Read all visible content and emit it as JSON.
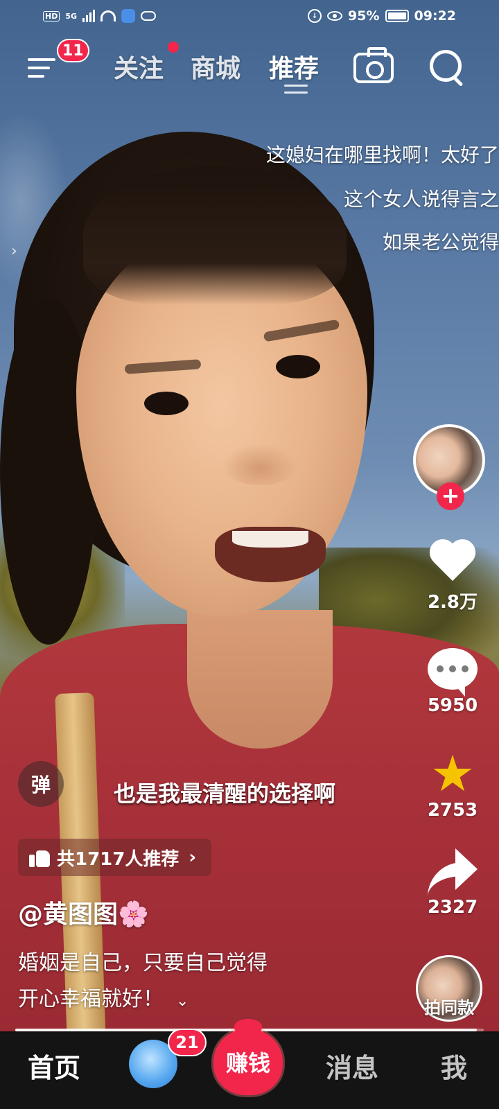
{
  "status_bar": {
    "hd": "HD",
    "network": "5G",
    "battery_percent": "95%",
    "time": "09:22"
  },
  "top_nav": {
    "menu_badge": "11",
    "tabs": [
      "关注",
      "商城",
      "推荐"
    ],
    "active_tab": "推荐"
  },
  "danmaku": [
    "这媳妇在哪里找啊！太好了",
    "这个女人说得言之",
    "如果老公觉得"
  ],
  "side_actions": {
    "likes": "2.8万",
    "comments": "5950",
    "favorites": "2753",
    "shares": "2327",
    "same_style_label": "拍同款"
  },
  "video": {
    "danmu_toggle": "弹",
    "subtitle": "也是我最清醒的选择啊",
    "recommend_text": "共1717人推荐",
    "author": "@黄图图",
    "author_emoji": "🌸",
    "description_line1": "婚姻是自己，只要自己觉得",
    "description_line2": "开心幸福就好！",
    "progress": 0.985
  },
  "bottom_nav": {
    "home": "首页",
    "friend_badge": "21",
    "earn": "赚钱",
    "messages": "消息",
    "me": "我"
  },
  "colors": {
    "accent": "#f2264b",
    "favorite_star": "#f6c300",
    "nav_bg": "#141414"
  },
  "icons": [
    "menu-icon",
    "camera-icon",
    "search-icon",
    "heart-icon",
    "comment-icon",
    "star-icon",
    "share-icon",
    "thumbs-up-icon",
    "chevron-right-icon",
    "chevron-down-icon",
    "swap-icon",
    "plus-icon"
  ]
}
